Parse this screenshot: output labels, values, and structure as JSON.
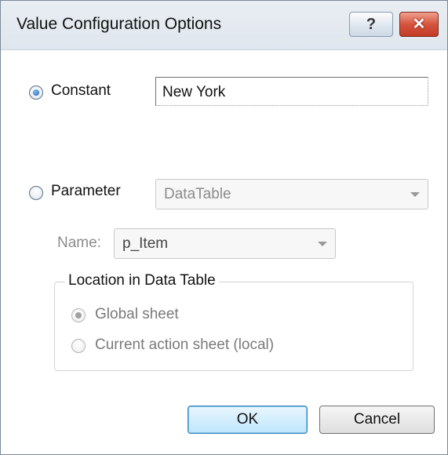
{
  "dialog": {
    "title": "Value Configuration Options",
    "help_label": "?",
    "close_label": "✕"
  },
  "constant": {
    "label": "Constant",
    "selected": true,
    "value": "New York"
  },
  "parameter": {
    "label": "Parameter",
    "selected": false,
    "type_value": "DataTable",
    "name_label": "Name:",
    "name_value": "p_Item"
  },
  "location": {
    "title": "Location in Data Table",
    "options": [
      {
        "label": "Global sheet",
        "selected": true
      },
      {
        "label": "Current action sheet (local)",
        "selected": false
      }
    ]
  },
  "buttons": {
    "ok": "OK",
    "cancel": "Cancel"
  },
  "colors": {
    "close_button": "#d5543e",
    "default_button_border": "#3c7fb1",
    "radio_selected": "#1a5fb4"
  }
}
